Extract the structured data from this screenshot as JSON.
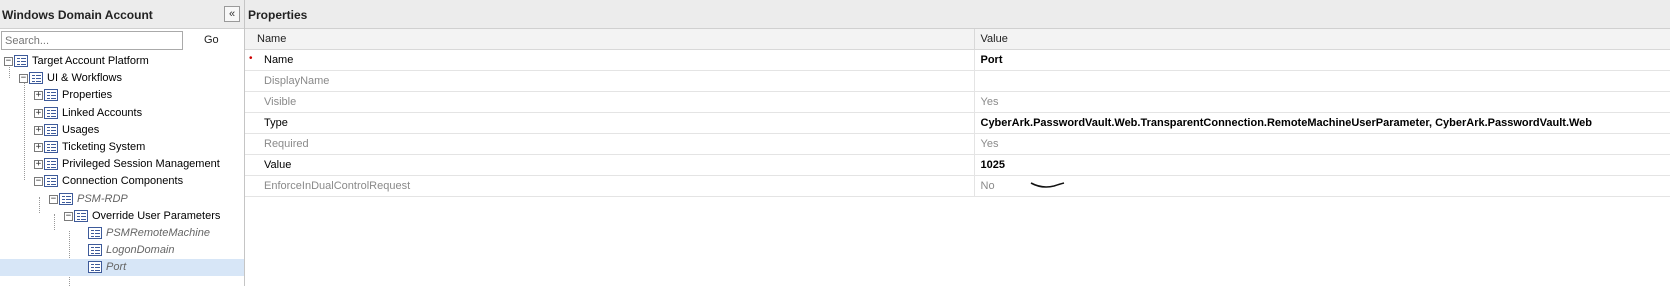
{
  "left_panel": {
    "title": "Windows Domain Account",
    "collapse_glyph": "«",
    "search_placeholder": "Search...",
    "go_label": "Go"
  },
  "tree": [
    {
      "label": "Target Account Platform",
      "expander": "−",
      "italic": false
    },
    {
      "label": "UI & Workflows",
      "expander": "−",
      "italic": false
    },
    {
      "label": "Properties",
      "expander": "+",
      "italic": false
    },
    {
      "label": "Linked Accounts",
      "expander": "+",
      "italic": false
    },
    {
      "label": "Usages",
      "expander": "+",
      "italic": false
    },
    {
      "label": "Ticketing System",
      "expander": "+",
      "italic": false
    },
    {
      "label": "Privileged Session Management",
      "expander": "+",
      "italic": false
    },
    {
      "label": "Connection Components",
      "expander": "−",
      "italic": false
    },
    {
      "label": "PSM-RDP",
      "expander": "−",
      "italic": true
    },
    {
      "label": "Override User Parameters",
      "expander": "−",
      "italic": false
    },
    {
      "label": "PSMRemoteMachine",
      "expander": "",
      "italic": true
    },
    {
      "label": "LogonDomain",
      "expander": "",
      "italic": true
    },
    {
      "label": "Port",
      "expander": "",
      "italic": true,
      "selected": true
    }
  ],
  "right_panel": {
    "title": "Properties",
    "columns": {
      "name": "Name",
      "value": "Value"
    },
    "rows": [
      {
        "name": "Name",
        "value": "Port",
        "required": true,
        "dim": false
      },
      {
        "name": "DisplayName",
        "value": "",
        "required": false,
        "dim": true
      },
      {
        "name": "Visible",
        "value": "Yes",
        "required": false,
        "dim": true
      },
      {
        "name": "Type",
        "value": "CyberArk.PasswordVault.Web.TransparentConnection.RemoteMachineUserParameter, CyberArk.PasswordVault.Web",
        "required": false,
        "dim": false
      },
      {
        "name": "Required",
        "value": "Yes",
        "required": false,
        "dim": true
      },
      {
        "name": "Value",
        "value": "1025",
        "required": false,
        "dim": false
      },
      {
        "name": "EnforceInDualControlRequest",
        "value": "No",
        "required": false,
        "dim": true
      }
    ],
    "required_marker": "•"
  }
}
